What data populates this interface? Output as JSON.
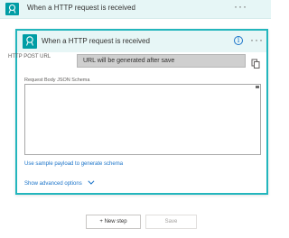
{
  "top_card": {
    "title": "When a HTTP request is received",
    "menu_glyph": "···",
    "icon": "http-trigger-icon"
  },
  "trigger_card": {
    "title": "When a HTTP request is received",
    "info_glyph": "i",
    "menu_glyph": "···",
    "icon": "http-trigger-icon",
    "http_post_url": {
      "label": "HTTP POST URL",
      "value": "URL will be generated after save",
      "copy_icon": "copy-icon"
    },
    "schema": {
      "label": "Request Body JSON Schema",
      "value": ""
    },
    "sample_payload_link": "Use sample payload to generate schema",
    "advanced_options_link": "Show advanced options"
  },
  "footer": {
    "new_step_label": "+ New step",
    "save_label": "Save"
  },
  "colors": {
    "accent": "#23b6bd",
    "icon_tile": "#009da5",
    "header_bg": "#e7f6f6",
    "link": "#1a73c9"
  }
}
